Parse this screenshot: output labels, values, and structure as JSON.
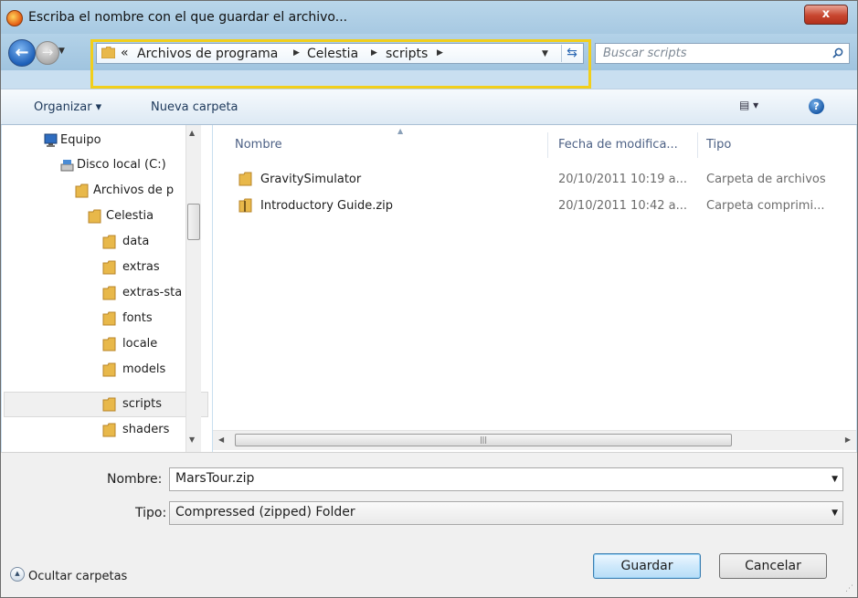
{
  "window": {
    "title": "Escriba el nombre con el que guardar el archivo...",
    "close_label": "x"
  },
  "nav": {
    "back_glyph": "←",
    "forward_glyph": "→",
    "breadcrumb_prefix": "«",
    "breadcrumbs": [
      "Archivos de programa",
      "Celestia",
      "scripts"
    ],
    "search_placeholder": "Buscar scripts"
  },
  "toolbar": {
    "organize_label": "Organizar ▾",
    "new_folder_label": "Nueva carpeta",
    "views_label": "▤ ▾",
    "help_label": "?"
  },
  "tree": {
    "items": [
      {
        "label": "Equipo",
        "icon": "computer-icon"
      },
      {
        "label": "Disco local (C:)",
        "icon": "drive-icon"
      },
      {
        "label": "Archivos de p",
        "icon": "folder-icon"
      },
      {
        "label": "Celestia",
        "icon": "folder-icon"
      },
      {
        "label": "data",
        "icon": "folder-icon"
      },
      {
        "label": "extras",
        "icon": "folder-icon"
      },
      {
        "label": "extras-sta",
        "icon": "folder-icon"
      },
      {
        "label": "fonts",
        "icon": "folder-icon"
      },
      {
        "label": "locale",
        "icon": "folder-icon"
      },
      {
        "label": "models",
        "icon": "folder-icon"
      },
      {
        "label": "scripts",
        "icon": "folder-icon"
      },
      {
        "label": "shaders",
        "icon": "folder-icon"
      }
    ],
    "selected": "scripts"
  },
  "files": {
    "columns": [
      "Nombre",
      "Fecha de modifica...",
      "Tipo"
    ],
    "rows": [
      {
        "name": "GravitySimulator",
        "date": "20/10/2011 10:19 a...",
        "type": "Carpeta de archivos",
        "icon": "folder-icon"
      },
      {
        "name": "Introductory Guide.zip",
        "date": "20/10/2011 10:42 a...",
        "type": "Carpeta comprimi...",
        "icon": "zip-folder-icon"
      }
    ]
  },
  "form": {
    "name_label": "Nombre:",
    "name_value": "MarsTour.zip",
    "type_label": "Tipo:",
    "type_value": "Compressed (zipped) Folder"
  },
  "footer": {
    "hide_folders_label": "Ocultar carpetas",
    "save_label": "Guardar",
    "cancel_label": "Cancelar"
  },
  "colors": {
    "highlight": "#f2cf1a",
    "chrome": "#a7c9e2",
    "folder": "#e8b84a"
  }
}
